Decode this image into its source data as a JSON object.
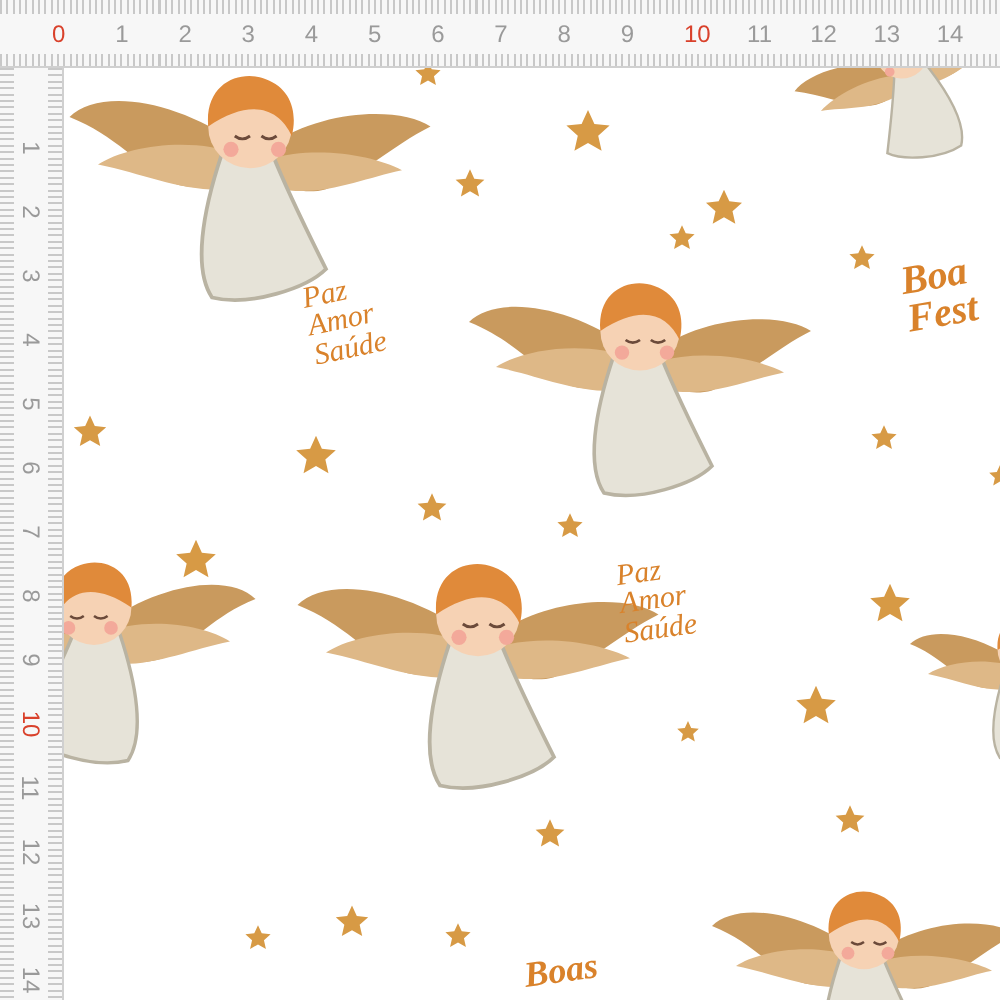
{
  "ruler_top": {
    "labels": [
      {
        "text": "0",
        "color": "#d9412b"
      },
      {
        "text": "1",
        "color": "#9a9a9a"
      },
      {
        "text": "2",
        "color": "#9a9a9a"
      },
      {
        "text": "3",
        "color": "#9a9a9a"
      },
      {
        "text": "4",
        "color": "#9a9a9a"
      },
      {
        "text": "5",
        "color": "#9a9a9a"
      },
      {
        "text": "6",
        "color": "#9a9a9a"
      },
      {
        "text": "7",
        "color": "#9a9a9a"
      },
      {
        "text": "8",
        "color": "#9a9a9a"
      },
      {
        "text": "9",
        "color": "#9a9a9a"
      },
      {
        "text": "10",
        "color": "#d9412b"
      },
      {
        "text": "11",
        "color": "#9a9a9a"
      },
      {
        "text": "12",
        "color": "#9a9a9a"
      },
      {
        "text": "13",
        "color": "#9a9a9a"
      },
      {
        "text": "14",
        "color": "#9a9a9a"
      }
    ]
  },
  "ruler_left": {
    "labels": [
      {
        "text": "1",
        "color": "#9a9a9a"
      },
      {
        "text": "2",
        "color": "#9a9a9a"
      },
      {
        "text": "3",
        "color": "#9a9a9a"
      },
      {
        "text": "4",
        "color": "#9a9a9a"
      },
      {
        "text": "5",
        "color": "#9a9a9a"
      },
      {
        "text": "6",
        "color": "#9a9a9a"
      },
      {
        "text": "7",
        "color": "#9a9a9a"
      },
      {
        "text": "8",
        "color": "#9a9a9a"
      },
      {
        "text": "9",
        "color": "#9a9a9a"
      },
      {
        "text": "10",
        "color": "#d9412b"
      },
      {
        "text": "11",
        "color": "#9a9a9a"
      },
      {
        "text": "12",
        "color": "#9a9a9a"
      },
      {
        "text": "13",
        "color": "#9a9a9a"
      },
      {
        "text": "14",
        "color": "#9a9a9a"
      }
    ]
  },
  "pattern": {
    "lettering": [
      {
        "lines": [
          "Paz",
          "Amor",
          "Saúde"
        ]
      },
      {
        "lines": [
          "Paz",
          "Amor",
          "Saúde"
        ]
      },
      {
        "lines": [
          "Boa",
          "Fest"
        ]
      },
      {
        "lines": [
          "Boas"
        ]
      }
    ]
  }
}
